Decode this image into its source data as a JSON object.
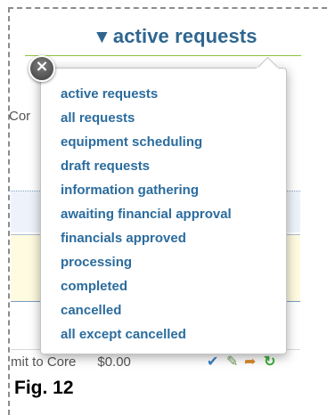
{
  "header": {
    "triangle": "▼",
    "title": "active requests"
  },
  "background": {
    "partial_label": "Cor",
    "footer_row": {
      "text": "mit to Core",
      "amount": "$0.00"
    },
    "row_icons": [
      "check-icon",
      "edit-icon",
      "forward-icon",
      "refresh-icon"
    ]
  },
  "dropdown": {
    "close_label": "×",
    "items": [
      {
        "label": "active requests"
      },
      {
        "label": "all requests"
      },
      {
        "label": "equipment scheduling"
      },
      {
        "label": "draft requests"
      },
      {
        "label": "information gathering"
      },
      {
        "label": "awaiting financial approval"
      },
      {
        "label": "financials approved"
      },
      {
        "label": "processing"
      },
      {
        "label": "completed"
      },
      {
        "label": "cancelled"
      },
      {
        "label": "all except cancelled"
      }
    ]
  },
  "caption": "Fig. 12",
  "colors": {
    "link": "#2b6c9e",
    "title": "#2f6690",
    "header_rule": "#8cc43f",
    "close_button": "#555555"
  }
}
